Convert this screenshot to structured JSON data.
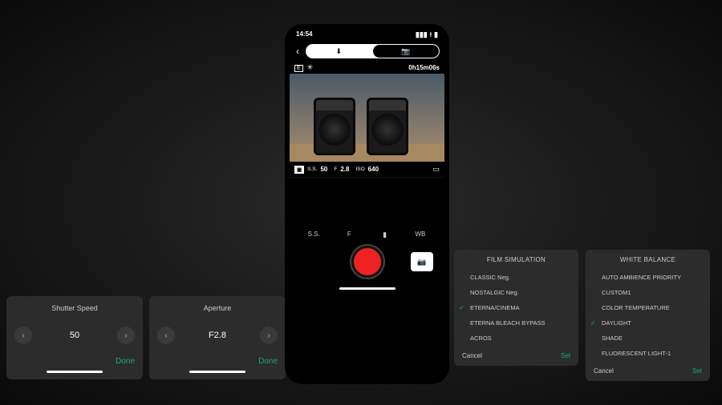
{
  "phone": {
    "status": {
      "time": "14:54",
      "loc_icon": "➤",
      "signal_icon": "▮▮▮",
      "wifi_icon": "⟊",
      "battery_icon": "▮"
    },
    "nav": {
      "download_icon": "⬇",
      "camera_icon": "📷"
    },
    "info": {
      "e_badge": "E",
      "wb_icon": "✳",
      "timer": "0h15m06s"
    },
    "exposure": {
      "focus_icon": "▣",
      "ss_label": "S.S.",
      "ss_value": "50",
      "f_label": "F",
      "f_value": "2.8",
      "iso_label": "ISO",
      "iso_value": "640",
      "battery_icon": "▭"
    },
    "tabs": {
      "ss": "S.S.",
      "f": "F",
      "film_icon": "▮",
      "wb": "WB"
    },
    "rec": {
      "camera_icon": "📷"
    }
  },
  "shutter_panel": {
    "title": "Shutter Speed",
    "value": "50",
    "done": "Done"
  },
  "aperture_panel": {
    "title": "Aperture",
    "value": "F2.8",
    "done": "Done"
  },
  "film_panel": {
    "title": "FILM SIMULATION",
    "items": [
      {
        "label": "CLASSIC Neg.",
        "selected": false
      },
      {
        "label": "NOSTALGIC Neg.",
        "selected": false
      },
      {
        "label": "ETERNA/CINEMA",
        "selected": true
      },
      {
        "label": "ETERNA BLEACH BYPASS",
        "selected": false
      },
      {
        "label": "ACROS",
        "selected": false
      }
    ],
    "cancel": "Cancel",
    "set": "Set"
  },
  "wb_panel": {
    "title": "WHITE BALANCE",
    "items": [
      {
        "label": "AUTO AMBIENCE PRIORITY",
        "selected": false
      },
      {
        "label": "CUSTOM1",
        "selected": false
      },
      {
        "label": "COLOR TEMPERATURE",
        "selected": false
      },
      {
        "label": "DAYLIGHT",
        "selected": true
      },
      {
        "label": "SHADE",
        "selected": false
      },
      {
        "label": "FLUORESCENT LIGHT-1",
        "selected": false
      }
    ],
    "cancel": "Cancel",
    "set": "Set"
  }
}
